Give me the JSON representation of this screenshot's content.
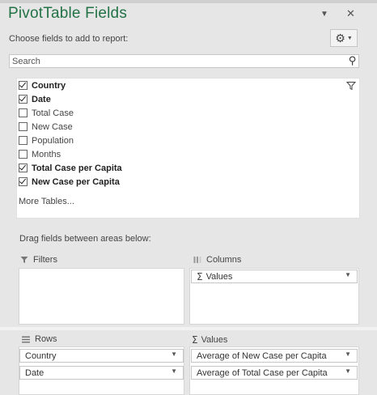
{
  "header": {
    "title": "PivotTable Fields",
    "chevron_glyph": "▼",
    "close_glyph": "✕"
  },
  "choose": {
    "label": "Choose fields to add to report:",
    "settings_icon": "gear-icon",
    "settings_glyph": "⚙",
    "caret_glyph": "▼"
  },
  "search": {
    "placeholder": "Search",
    "icon": "search-icon",
    "glyph": "⚲"
  },
  "fields": [
    {
      "label": "Country",
      "checked": true
    },
    {
      "label": "Date",
      "checked": true
    },
    {
      "label": "Total Case",
      "checked": false
    },
    {
      "label": "New Case",
      "checked": false
    },
    {
      "label": "Population",
      "checked": false
    },
    {
      "label": "Months",
      "checked": false
    },
    {
      "label": "Total Case per Capita",
      "checked": true
    },
    {
      "label": "New Case per Capita",
      "checked": true
    }
  ],
  "more_tables": "More Tables...",
  "drag_label": "Drag fields between areas below:",
  "areas": {
    "filters": {
      "label": "Filters",
      "icon": "filter-icon"
    },
    "columns": {
      "label": "Columns",
      "icon": "columns-icon",
      "items": [
        {
          "label": "Values"
        }
      ]
    },
    "rows": {
      "label": "Rows",
      "icon": "rows-icon",
      "items": [
        {
          "label": "Country"
        },
        {
          "label": "Date"
        }
      ]
    },
    "values": {
      "label": "Values",
      "icon": "sigma-icon",
      "sigma_glyph": "Σ",
      "items": [
        {
          "label": "Average of New Case per Capita"
        },
        {
          "label": "Average of Total Case per Capita"
        }
      ]
    }
  },
  "dropdown_glyph": "▼",
  "colors": {
    "accent": "#217346",
    "panel": "#e6e6e6",
    "text": "#444444"
  }
}
